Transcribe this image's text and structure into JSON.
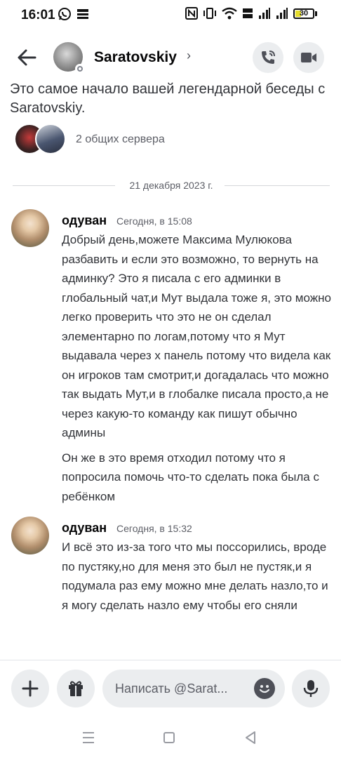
{
  "status_bar": {
    "time": "16:01",
    "battery": "30"
  },
  "header": {
    "name": "Saratovskiy",
    "chevron": "›"
  },
  "intro": {
    "text": "Это самое начало вашей легендарной беседы с Saratovskiy.",
    "servers_label": "2 общих сервера"
  },
  "divider": {
    "date": "21 декабря 2023 г."
  },
  "messages": [
    {
      "author": "одуван",
      "time": "Сегодня, в 15:08",
      "paragraphs": [
        "Добрый день,можете Максима Мулюкова разбавить и если это возможно, то вернуть на админку? Это я писала с его админки в глобальный чат,и Мут выдала тоже я, это можно легко проверить что это не он сделал элементарно по логам,потому что я Мут выдавала через х панель потому что видела как он игроков там смотрит,и догадалась что можно так выдать Мут,и в глобалке писала просто,а не через какую-то команду как пишут обычно админы",
        "Он же в это время отходил потому что я попросила помочь что-то сделать пока была с ребёнком"
      ]
    },
    {
      "author": "одуван",
      "time": "Сегодня, в 15:32",
      "paragraphs": [
        "И всё это из-за того что мы поссорились, вроде по пустяку,но для меня это был не пустяк,и я подумала раз ему можно мне делать назло,то и я могу сделать назло ему чтобы его сняли"
      ]
    }
  ],
  "composer": {
    "placeholder": "Написать @Sarat..."
  },
  "icons": {
    "back": "arrow-left-icon",
    "call": "phone-call-icon",
    "video": "video-camera-icon",
    "add": "plus-icon",
    "gift": "gift-icon",
    "emoji": "emoji-icon",
    "mic": "microphone-icon",
    "nav_menu": "menu-lines-icon",
    "nav_home": "square-icon",
    "nav_back": "triangle-back-icon"
  },
  "colors": {
    "background": "#ffffff",
    "text": "#313338",
    "muted": "#5c5e66",
    "button_bg": "#ebedef"
  }
}
